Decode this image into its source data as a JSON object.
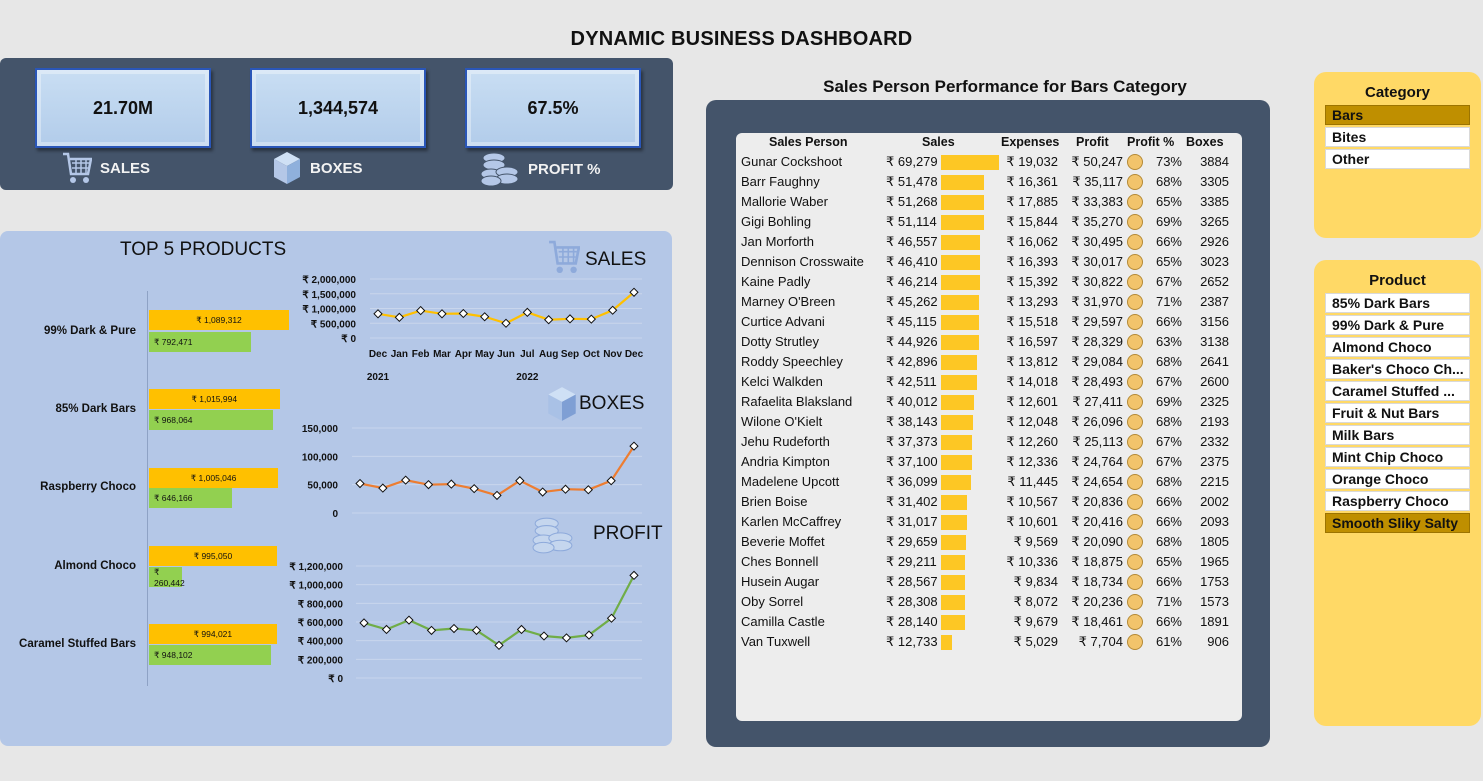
{
  "title": "DYNAMIC BUSINESS DASHBOARD",
  "kpis": [
    {
      "value": "21.70M",
      "label": "SALES",
      "icon": "cart-icon"
    },
    {
      "value": "1,344,574",
      "label": "BOXES",
      "icon": "box-icon"
    },
    {
      "value": "67.5%",
      "label": "PROFIT %",
      "icon": "coins-icon"
    }
  ],
  "top5": {
    "title": "TOP 5 PRODUCTS",
    "products": [
      {
        "name": "99% Dark & Pure",
        "sales": "₹ 1,089,312",
        "boxes": "₹ 792,471",
        "sales_val": 1089312,
        "boxes_val": 792471
      },
      {
        "name": "85% Dark Bars",
        "sales": "₹ 1,015,994",
        "boxes": "₹ 968,064",
        "sales_val": 1015994,
        "boxes_val": 968064
      },
      {
        "name": "Raspberry Choco",
        "sales": "₹ 1,005,046",
        "boxes": "₹ 646,166",
        "sales_val": 1005046,
        "boxes_val": 646166
      },
      {
        "name": "Almond Choco",
        "sales": "₹ 995,050",
        "boxes": "₹ 260,442",
        "sales_val": 995050,
        "boxes_val": 260442
      },
      {
        "name": "Caramel Stuffed Bars",
        "sales": "₹ 994,021",
        "boxes": "₹ 948,102",
        "sales_val": 994021,
        "boxes_val": 948102
      }
    ]
  },
  "sections": {
    "sales": "SALES",
    "boxes": "BOXES",
    "profit": "PROFIT"
  },
  "chart_data": [
    {
      "type": "line",
      "name": "sales",
      "x": [
        "Dec",
        "Jan",
        "Feb",
        "Mar",
        "Apr",
        "May",
        "Jun",
        "Jul",
        "Aug",
        "Sep",
        "Oct",
        "Nov",
        "Dec"
      ],
      "years": [
        {
          "label": "2021"
        },
        {
          "label": "2022"
        }
      ],
      "values": [
        820000,
        700000,
        930000,
        820000,
        830000,
        720000,
        500000,
        870000,
        620000,
        650000,
        640000,
        940000,
        1550000
      ],
      "yticks": [
        "₹ 2,000,000",
        "₹ 1,500,000",
        "₹ 1,000,000",
        "₹ 500,000",
        "₹ 0"
      ],
      "ylim": [
        0,
        2000000
      ],
      "color": "#ffc000"
    },
    {
      "type": "line",
      "name": "boxes",
      "values": [
        52000,
        44000,
        58000,
        50000,
        51000,
        43000,
        31000,
        57000,
        37000,
        42000,
        41000,
        57000,
        118000
      ],
      "yticks": [
        "150,000",
        "100,000",
        "50,000",
        "0"
      ],
      "ylim": [
        0,
        150000
      ],
      "color": "#ed7d31"
    },
    {
      "type": "line",
      "name": "profit",
      "values": [
        590000,
        520000,
        620000,
        510000,
        530000,
        510000,
        350000,
        520000,
        450000,
        430000,
        460000,
        640000,
        1100000
      ],
      "yticks": [
        "₹ 1,200,000",
        "₹ 1,000,000",
        "₹ 800,000",
        "₹ 600,000",
        "₹ 400,000",
        "₹ 200,000",
        "₹ 0"
      ],
      "ylim": [
        0,
        1200000
      ],
      "color": "#70ad47"
    }
  ],
  "salesperson": {
    "title": "Sales Person Performance for Bars Category",
    "headers": [
      "Sales Person",
      "Sales",
      "Expenses",
      "Profit",
      "Profit %",
      "Boxes"
    ],
    "rows": [
      {
        "name": "Gunar Cockshoot",
        "sales": "₹ 69,279",
        "sv": 69279,
        "exp": "₹ 19,032",
        "profit": "₹ 50,247",
        "pct": "73%",
        "boxes": "3884"
      },
      {
        "name": "Barr Faughny",
        "sales": "₹ 51,478",
        "sv": 51478,
        "exp": "₹ 16,361",
        "profit": "₹ 35,117",
        "pct": "68%",
        "boxes": "3305"
      },
      {
        "name": "Mallorie Waber",
        "sales": "₹ 51,268",
        "sv": 51268,
        "exp": "₹ 17,885",
        "profit": "₹ 33,383",
        "pct": "65%",
        "boxes": "3385"
      },
      {
        "name": "Gigi Bohling",
        "sales": "₹ 51,114",
        "sv": 51114,
        "exp": "₹ 15,844",
        "profit": "₹ 35,270",
        "pct": "69%",
        "boxes": "3265"
      },
      {
        "name": "Jan Morforth",
        "sales": "₹ 46,557",
        "sv": 46557,
        "exp": "₹ 16,062",
        "profit": "₹ 30,495",
        "pct": "66%",
        "boxes": "2926"
      },
      {
        "name": "Dennison Crosswaite",
        "sales": "₹ 46,410",
        "sv": 46410,
        "exp": "₹ 16,393",
        "profit": "₹ 30,017",
        "pct": "65%",
        "boxes": "3023"
      },
      {
        "name": "Kaine Padly",
        "sales": "₹ 46,214",
        "sv": 46214,
        "exp": "₹ 15,392",
        "profit": "₹ 30,822",
        "pct": "67%",
        "boxes": "2652"
      },
      {
        "name": "Marney O'Breen",
        "sales": "₹ 45,262",
        "sv": 45262,
        "exp": "₹ 13,293",
        "profit": "₹ 31,970",
        "pct": "71%",
        "boxes": "2387"
      },
      {
        "name": "Curtice Advani",
        "sales": "₹ 45,115",
        "sv": 45115,
        "exp": "₹ 15,518",
        "profit": "₹ 29,597",
        "pct": "66%",
        "boxes": "3156"
      },
      {
        "name": "Dotty Strutley",
        "sales": "₹ 44,926",
        "sv": 44926,
        "exp": "₹ 16,597",
        "profit": "₹ 28,329",
        "pct": "63%",
        "boxes": "3138"
      },
      {
        "name": "Roddy Speechley",
        "sales": "₹ 42,896",
        "sv": 42896,
        "exp": "₹ 13,812",
        "profit": "₹ 29,084",
        "pct": "68%",
        "boxes": "2641"
      },
      {
        "name": "Kelci Walkden",
        "sales": "₹ 42,511",
        "sv": 42511,
        "exp": "₹ 14,018",
        "profit": "₹ 28,493",
        "pct": "67%",
        "boxes": "2600"
      },
      {
        "name": "Rafaelita Blaksland",
        "sales": "₹ 40,012",
        "sv": 40012,
        "exp": "₹ 12,601",
        "profit": "₹ 27,411",
        "pct": "69%",
        "boxes": "2325"
      },
      {
        "name": "Wilone O'Kielt",
        "sales": "₹ 38,143",
        "sv": 38143,
        "exp": "₹ 12,048",
        "profit": "₹ 26,096",
        "pct": "68%",
        "boxes": "2193"
      },
      {
        "name": "Jehu Rudeforth",
        "sales": "₹ 37,373",
        "sv": 37373,
        "exp": "₹ 12,260",
        "profit": "₹ 25,113",
        "pct": "67%",
        "boxes": "2332"
      },
      {
        "name": "Andria Kimpton",
        "sales": "₹ 37,100",
        "sv": 37100,
        "exp": "₹ 12,336",
        "profit": "₹ 24,764",
        "pct": "67%",
        "boxes": "2375"
      },
      {
        "name": "Madelene Upcott",
        "sales": "₹ 36,099",
        "sv": 36099,
        "exp": "₹ 11,445",
        "profit": "₹ 24,654",
        "pct": "68%",
        "boxes": "2215"
      },
      {
        "name": "Brien Boise",
        "sales": "₹ 31,402",
        "sv": 31402,
        "exp": "₹ 10,567",
        "profit": "₹ 20,836",
        "pct": "66%",
        "boxes": "2002"
      },
      {
        "name": "Karlen McCaffrey",
        "sales": "₹ 31,017",
        "sv": 31017,
        "exp": "₹ 10,601",
        "profit": "₹ 20,416",
        "pct": "66%",
        "boxes": "2093"
      },
      {
        "name": "Beverie Moffet",
        "sales": "₹ 29,659",
        "sv": 29659,
        "exp": "₹ 9,569",
        "profit": "₹ 20,090",
        "pct": "68%",
        "boxes": "1805"
      },
      {
        "name": "Ches Bonnell",
        "sales": "₹ 29,211",
        "sv": 29211,
        "exp": "₹ 10,336",
        "profit": "₹ 18,875",
        "pct": "65%",
        "boxes": "1965"
      },
      {
        "name": "Husein Augar",
        "sales": "₹ 28,567",
        "sv": 28567,
        "exp": "₹ 9,834",
        "profit": "₹ 18,734",
        "pct": "66%",
        "boxes": "1753"
      },
      {
        "name": "Oby Sorrel",
        "sales": "₹ 28,308",
        "sv": 28308,
        "exp": "₹ 8,072",
        "profit": "₹ 20,236",
        "pct": "71%",
        "boxes": "1573"
      },
      {
        "name": "Camilla Castle",
        "sales": "₹ 28,140",
        "sv": 28140,
        "exp": "₹ 9,679",
        "profit": "₹ 18,461",
        "pct": "66%",
        "boxes": "1891"
      },
      {
        "name": "Van Tuxwell",
        "sales": "₹ 12,733",
        "sv": 12733,
        "exp": "₹ 5,029",
        "profit": "₹ 7,704",
        "pct": "61%",
        "boxes": "906"
      }
    ]
  },
  "slicers": {
    "category": {
      "title": "Category",
      "items": [
        {
          "label": "Bars",
          "selected": true
        },
        {
          "label": "Bites",
          "selected": false
        },
        {
          "label": "Other",
          "selected": false
        }
      ]
    },
    "product": {
      "title": "Product",
      "items": [
        {
          "label": "85% Dark Bars",
          "selected": false
        },
        {
          "label": "99% Dark & Pure",
          "selected": false
        },
        {
          "label": "Almond Choco",
          "selected": false
        },
        {
          "label": "Baker's Choco Ch...",
          "selected": false
        },
        {
          "label": "Caramel Stuffed ...",
          "selected": false
        },
        {
          "label": "Fruit & Nut Bars",
          "selected": false
        },
        {
          "label": "Milk Bars",
          "selected": false
        },
        {
          "label": "Mint Chip Choco",
          "selected": false
        },
        {
          "label": "Orange Choco",
          "selected": false
        },
        {
          "label": "Raspberry Choco",
          "selected": false
        },
        {
          "label": "Smooth Sliky Salty",
          "selected": true
        }
      ]
    }
  },
  "colors": {
    "panel_dark": "#44546a",
    "panel_blue": "#b4c7e7",
    "gold": "#ffc000",
    "green": "#92d050",
    "slicer": "#ffd966",
    "slicer_selected": "#bf8f00"
  }
}
